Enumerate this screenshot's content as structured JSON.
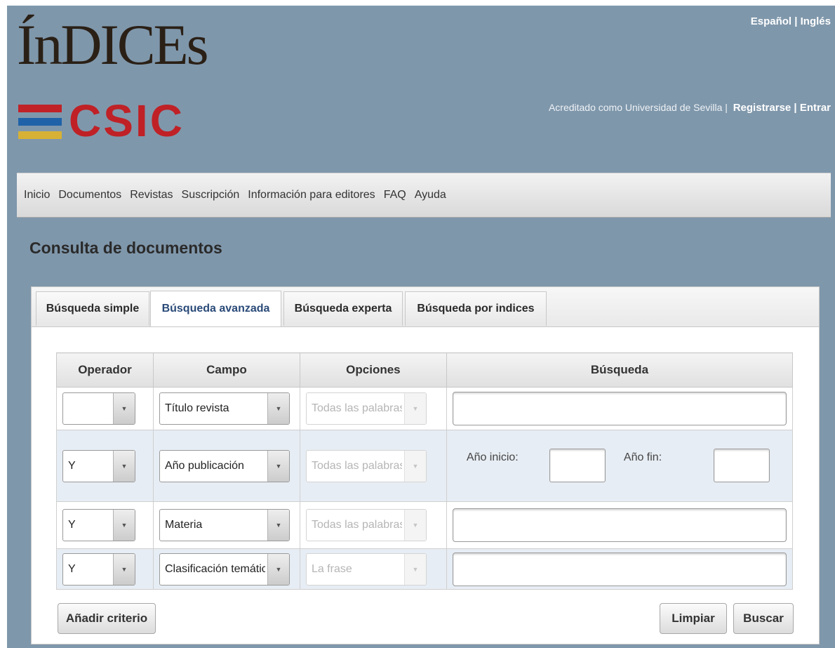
{
  "header": {
    "logo_top": "ÍnDICEs",
    "logo_bottom": "CSIC",
    "lang_es": "Español",
    "lang_sep": " | ",
    "lang_en": "Inglés",
    "accredited": "Acreditado como Universidad de Sevilla |",
    "register": "Registrarse",
    "account_sep": " | ",
    "login": "Entrar"
  },
  "nav": {
    "items": [
      "Inicio",
      "Documentos",
      "Revistas",
      "Suscripción",
      "Información para editores",
      "FAQ",
      "Ayuda"
    ]
  },
  "page_title": "Consulta de documentos",
  "tabs": [
    "Búsqueda simple",
    "Búsqueda avanzada",
    "Búsqueda experta",
    "Búsqueda por indices"
  ],
  "active_tab": "Búsqueda avanzada",
  "table": {
    "headers": [
      "Operador",
      "Campo",
      "Opciones",
      "Búsqueda"
    ],
    "rows": [
      {
        "operador": "",
        "campo": "Título revista",
        "opciones": "Todas las palabras",
        "busqueda": ""
      },
      {
        "operador": "Y",
        "campo": "Año publicación",
        "opciones": "Todas las palabras",
        "year_start_label": "Año inicio:",
        "year_end_label": "Año fin:",
        "year_start": "",
        "year_end": ""
      },
      {
        "operador": "Y",
        "campo": "Materia",
        "opciones": "Todas las palabras",
        "busqueda": ""
      },
      {
        "operador": "Y",
        "campo": "Clasificación temática",
        "opciones": "La frase",
        "busqueda": ""
      }
    ]
  },
  "buttons": {
    "add": "Añadir criterio",
    "clear": "Limpiar",
    "search": "Buscar"
  },
  "icons": {
    "dropdown": "▼"
  },
  "colors": {
    "page_background": "#7f97ab",
    "logo_red": "#bf2126",
    "stripe_blue": "#1f62a8",
    "stripe_yellow": "#d6b136",
    "alt_row": "#e7edf4"
  }
}
